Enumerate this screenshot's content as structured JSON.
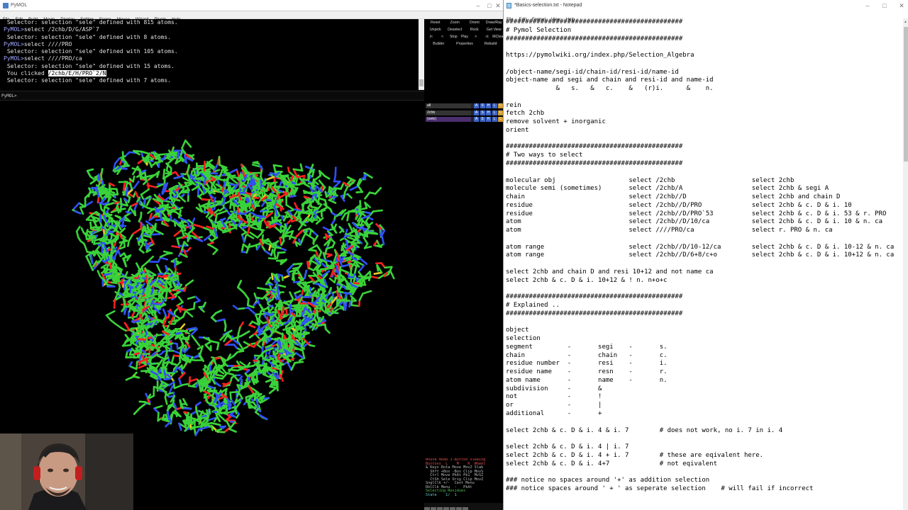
{
  "pymol": {
    "title": "PyMOL",
    "menu": [
      "File",
      "Edit",
      "Build",
      "Movie",
      "Display",
      "Setting",
      "Scene",
      "Mouse",
      "Wizard",
      "Plugin",
      "Help"
    ],
    "console_lines": [
      {
        "type": "out",
        "text": " Selector: selection \"sele\" defined with 815 atoms."
      },
      {
        "type": "cmd",
        "prompt": "PyMOL>",
        "text": "select /2chb/D/G/ASP`7"
      },
      {
        "type": "out",
        "text": " Selector: selection \"sele\" defined with 8 atoms."
      },
      {
        "type": "cmd",
        "prompt": "PyMOL>",
        "text": "select ////PRO"
      },
      {
        "type": "out",
        "text": " Selector: selection \"sele\" defined with 105 atoms."
      },
      {
        "type": "cmd",
        "prompt": "PyMOL>",
        "text": "select ////PRO/ca"
      },
      {
        "type": "out",
        "text": " Selector: selection \"sele\" defined with 15 atoms."
      },
      {
        "type": "click",
        "prefix": " You clicked ",
        "hl": "/2chb/E/H/PRO`2/N"
      },
      {
        "type": "out",
        "text": " Selector: selection \"sele\" defined with 7 atoms."
      }
    ],
    "cmd_prompt": "PyMOL>",
    "controls": {
      "row1": [
        "Reset",
        "Zoom",
        "Orient",
        "Draw/Ray"
      ],
      "row2": [
        "Unpick",
        "Deselect",
        "Rock",
        "Get View"
      ],
      "row3": [
        "|<",
        "<",
        "Stop",
        "Play",
        ">",
        ">|",
        "MClear"
      ],
      "row4": [
        "Builder",
        "Properties",
        "Rebuild"
      ]
    },
    "objects": [
      {
        "name": "all",
        "boxes": [
          "A",
          "S",
          "H",
          "L",
          "C"
        ]
      },
      {
        "name": "2chb",
        "boxes": [
          "A",
          "S",
          "H",
          "L",
          "C"
        ]
      },
      {
        "name": "(sele)",
        "boxes": [
          "A",
          "S",
          "H",
          "L",
          "C"
        ]
      }
    ],
    "mouse_mode": {
      "header": "Mouse Mode 3-Button Viewing",
      "buttons_row": "Buttons  L    M    R  Wheel",
      "rows": [
        "& Keys Rota Move MovZ Slab",
        "  Shft +Box -Box Clip MovS",
        "  Ctrl Move PkAt Pk1  MvSZ",
        "  CtSh Sele Orig Clip MovZ",
        "SnglClk +/-  Cent Menu",
        "DblClk Menu  -   PkAt"
      ],
      "selecting": "Selecting Residues",
      "state": "State    1/  1"
    }
  },
  "notepad": {
    "title": "*Basics-selection.txt - Notepad",
    "menu": [
      "File",
      "Edit",
      "Format",
      "View",
      "Help"
    ],
    "lines": [
      "##############################################",
      "# Pymol Selection",
      "##############################################",
      "",
      "https://pymolwiki.org/index.php/Selection_Algebra",
      "",
      "/object-name/segi-id/chain-id/resi-id/name-id",
      "object-name and segi and chain and resi-id and name-id",
      "             &   s.   &   c.    &   (r)i.      &    n.",
      "",
      "rein",
      "fetch 2chb",
      "remove solvent + inorganic",
      "orient",
      "",
      "##############################################",
      "# Two ways to select",
      "##############################################",
      "",
      "molecular obj                   select /2chb                    select 2chb",
      "molecule semi (sometimes)       select /2chb/A                  select 2chb & segi A",
      "chain                           select /2chb//D                 select 2chb and chain D",
      "residue                         select /2chb//D/PRO             select 2chb & c. D & i. 10",
      "residue                         select /2chb//D/PRO`53          select 2chb & c. D & i. 53 & r. PRO",
      "atom                            select /2chb//D/10/ca           select 2chb & c. D & i. 10 & n. ca",
      "atom                            select ////PRO/ca               select r. PRO & n. ca",
      "",
      "atom range                      select /2chb//D/10-12/ca        select 2chb & c. D & i. 10-12 & n. ca",
      "atom range                      select /2chb//D/6+8/c+o         select 2chb & c. D & i. 10+12 & n. ca",
      "",
      "select 2chb and chain D and resi 10+12 and not name ca",
      "select 2chb & c. D & i. 10+12 & ! n. n+o+c",
      "",
      "##############################################",
      "# Explained ..",
      "##############################################",
      "",
      "object",
      "selection",
      "segment         -       segi    -       s.",
      "chain           -       chain   -       c.",
      "residue number  -       resi    -       i.",
      "residue name    -       resn    -       r.",
      "atom name       -       name    -       n.",
      "subdivision     -       &",
      "not             -       !",
      "or              -       |",
      "additional      -       +",
      "",
      "select 2chb & c. D & i. 4 & i. 7        # does not work, no i. 7 in i. 4",
      "",
      "select 2chb & c. D & i. 4 | i. 7",
      "select 2chb & c. D & i. 4 + i. 7        # these are eqivalent here.",
      "select 2chb & c. D & i. 4+7             # not eqivalent",
      "",
      "### notice no spaces around '+' as addition selection",
      "### notice spaces around ' + ' as seperate selection    # will fail if incorrect"
    ]
  },
  "colors": {
    "carbon": "#3ad23a",
    "nitrogen": "#3050f8",
    "oxygen": "#ff2020",
    "sulfur": "#e6c828",
    "prompt": "#9ea6ff"
  }
}
